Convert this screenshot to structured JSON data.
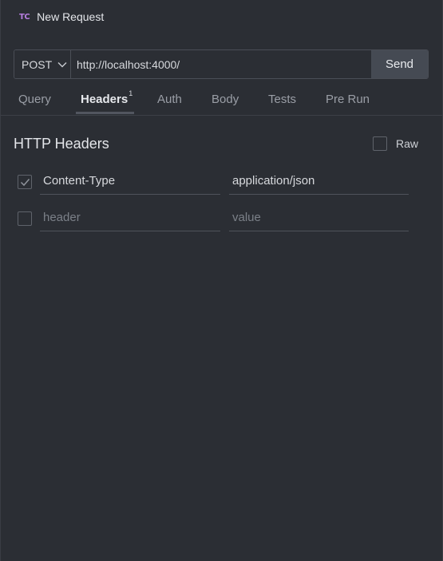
{
  "app": {
    "logo": "TC",
    "title": "New Request"
  },
  "request": {
    "method": "POST",
    "url": "http://localhost:4000/",
    "send_label": "Send"
  },
  "tabs": [
    {
      "label": "Query"
    },
    {
      "label": "Headers",
      "badge": "1"
    },
    {
      "label": "Auth"
    },
    {
      "label": "Body"
    },
    {
      "label": "Tests"
    },
    {
      "label": "Pre Run"
    }
  ],
  "headers_section": {
    "title": "HTTP Headers",
    "raw_label": "Raw",
    "raw_checked": false,
    "rows": [
      {
        "checked": true,
        "key": "Content-Type",
        "value": "application/json"
      }
    ],
    "placeholder": {
      "key": "header",
      "value": "value"
    }
  },
  "colors": {
    "background": "#2b2e34",
    "logo": "#b77ee0",
    "send_button": "#454a53"
  },
  "icons": [
    "chevron-down-icon",
    "checkmark-icon"
  ]
}
